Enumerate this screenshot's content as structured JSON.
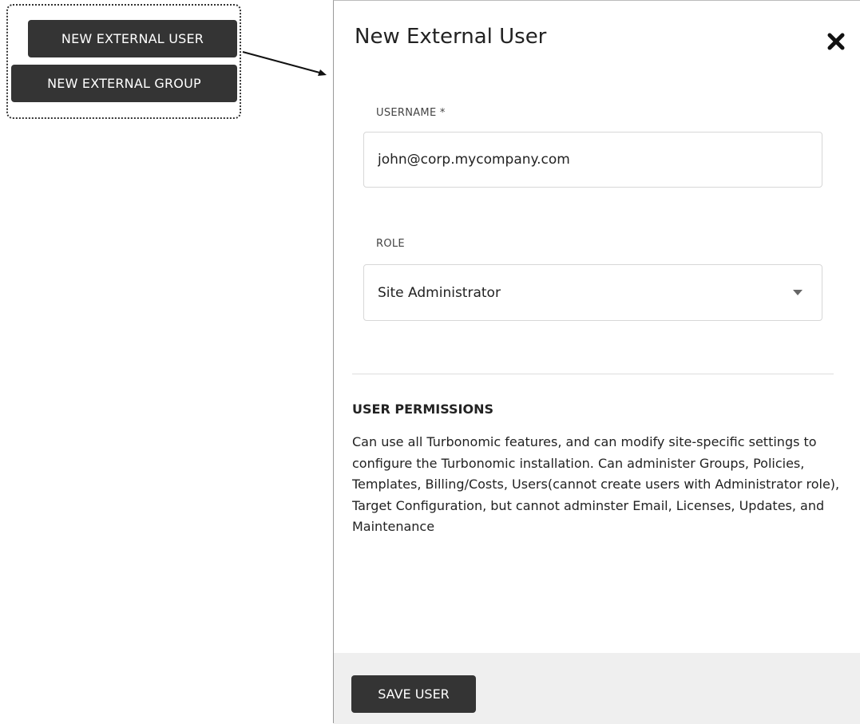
{
  "callout": {
    "new_external_user_label": "NEW EXTERNAL USER",
    "new_external_group_label": "NEW EXTERNAL GROUP"
  },
  "dialog": {
    "title": "New External User",
    "close_icon": "close-icon",
    "username": {
      "label": "USERNAME *",
      "value": "john@corp.mycompany.com"
    },
    "role": {
      "label": "ROLE",
      "selected": "Site Administrator",
      "icon": "chevron-down-icon"
    },
    "permissions": {
      "heading": "USER PERMISSIONS",
      "description": "Can use all Turbonomic features, and can modify site-specific settings to configure the Turbonomic installation. Can administer Groups, Policies, Templates, Billing/Costs, Users(cannot create users with Administrator role), Target Configuration, but cannot adminster Email, Licenses, Updates, and Maintenance"
    },
    "footer": {
      "save_label": "SAVE USER"
    }
  },
  "colors": {
    "button_dark": "#343434",
    "footer_bg": "#efefef",
    "border": "#d7d7d7"
  }
}
